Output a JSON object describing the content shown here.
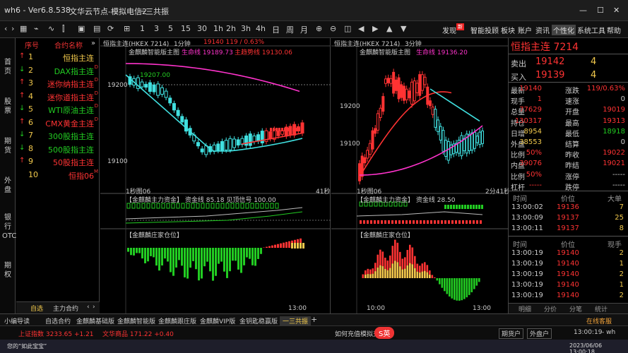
{
  "app": {
    "title": "wh6 - Ver6.8.538",
    "subtitle": "文华云节点-模拟电信2",
    "account": "一三共振"
  },
  "toolbar": {
    "periods": [
      "1",
      "3",
      "5",
      "15",
      "30",
      "1h",
      "2h",
      "3h",
      "4h",
      "日",
      "周",
      "月"
    ],
    "right": [
      "发现",
      "智能投顾",
      "板块",
      "账户",
      "资讯",
      "个性化",
      "系统工具",
      "帮助"
    ],
    "badge": "新"
  },
  "sidebar": [
    "首页",
    "股票",
    "期货",
    "外盘",
    "银行OTC",
    "期权"
  ],
  "list": {
    "headers": [
      "序号",
      "合约名称"
    ],
    "items": [
      {
        "no": "1",
        "name": "恒指主连",
        "dir": "up",
        "sup": ""
      },
      {
        "no": "2",
        "name": "DAX指主连",
        "dir": "down",
        "sup": "D"
      },
      {
        "no": "3",
        "name": "迷你纳指主连",
        "dir": "up",
        "sup": "D"
      },
      {
        "no": "4",
        "name": "迷你道指主连",
        "dir": "up",
        "sup": "D"
      },
      {
        "no": "5",
        "name": "WTI原油主连",
        "dir": "down",
        "sup": "D"
      },
      {
        "no": "6",
        "name": "CMX黄金主连",
        "dir": "up",
        "sup": "D"
      },
      {
        "no": "7",
        "name": "300股指主连",
        "dir": "down",
        "sup": ""
      },
      {
        "no": "8",
        "name": "500股指主连",
        "dir": "down",
        "sup": ""
      },
      {
        "no": "9",
        "name": "50股指主连",
        "dir": "up",
        "sup": ""
      },
      {
        "no": "10",
        "name": "恒指06",
        "dir": "",
        "sup": "M"
      }
    ],
    "tabs": [
      "自选",
      "主力合约"
    ]
  },
  "left_chart": {
    "header": "恒指主连(HKEX 7214)",
    "period": "1分钟",
    "title": "金麒麟智能版主图",
    "line1": "生命线 19189.73",
    "line2": "主趋势线 19130.06",
    "price_info": "19140   119 / 0.63%",
    "y_labels": [
      "19200",
      "19100"
    ],
    "mark": "19207.00",
    "footer_left": "1秒图06",
    "footer_right": "41秒",
    "sub1": "【金麒麟主力资金】 资金线 85.18  见顶信号 100.00",
    "sub2": "【金麒麟庄家仓位】",
    "time": "13:00"
  },
  "right_chart": {
    "header": "恒指主连(HKEX 7214)",
    "period": "3分钟",
    "title": "金麒麟智能版主图",
    "line1": "生命线 19136.20",
    "y_labels": [
      "19200",
      "19100"
    ],
    "footer_left": "1秒图06",
    "footer_right": "2分41秒",
    "sub1": "【金麒麟主力资金】 资金线 28.50",
    "sub2": "【金麒麟庄家仓位】",
    "time": "10:00",
    "time2": "13:00"
  },
  "quote": {
    "title": "恒指主连  7214",
    "sell": [
      "卖出",
      "19142",
      "4"
    ],
    "buy": [
      "买入",
      "19139",
      "4"
    ],
    "rows": [
      [
        "最新",
        "19140",
        "涨跌",
        "119/0.63%"
      ],
      [
        "现手",
        "1",
        "速涨",
        "0"
      ],
      [
        "总量",
        "77629",
        "开盘",
        "19019"
      ],
      [
        "持仓",
        "130317",
        "最高",
        "19313"
      ],
      [
        "日增",
        "8954",
        "最低",
        "18918"
      ],
      [
        "外盘",
        "38553",
        "结算",
        "0"
      ],
      [
        "比例",
        "50%",
        "昨收",
        "19022"
      ],
      [
        "内盘",
        "39076",
        "昨结",
        "19021"
      ],
      [
        "比例",
        "50%",
        "涨停",
        "-----"
      ],
      [
        "杠杆",
        "-----",
        "跌停",
        "-----"
      ]
    ],
    "ticks_head": [
      "时间",
      "价位",
      "大单"
    ],
    "ticks": [
      [
        "13:00:02",
        "19136",
        "7"
      ],
      [
        "13:00:09",
        "19137",
        "25"
      ],
      [
        "13:00:11",
        "19137",
        "8"
      ]
    ],
    "ticks_head2": [
      "时间",
      "价位",
      "现手"
    ],
    "ticks2": [
      [
        "13:00:19",
        "19140",
        "2"
      ],
      [
        "13:00:19",
        "19140",
        "1"
      ],
      [
        "13:00:19",
        "19140",
        "2"
      ],
      [
        "13:00:19",
        "19140",
        "1"
      ],
      [
        "13:00:19",
        "19140",
        "2"
      ]
    ],
    "tabs": [
      "明细",
      "分价",
      "分笔",
      "统计"
    ]
  },
  "bottom_tabs": [
    "小编导读",
    "自选合约",
    "金麒麟基础版",
    "金麒麟智能版",
    "金麒麟跟庄版",
    "金麒麟VIP版",
    "金钥匙稳赢版",
    "一三共振"
  ],
  "status": {
    "left1": "上证指数 3233.65 +1.21",
    "left2": "文华商品 171.22 +0.40",
    "center": "如何充值模拟交易",
    "right1": "期货户",
    "right2": "外盘户",
    "time": "13:00:19",
    "suffix": "- wh",
    "service": "在线客服"
  },
  "taskbar": {
    "left": "您的“如此宝宝”",
    "right": "2023/06/06 13:00:18"
  },
  "colors": {
    "up": "#ff3333",
    "down": "#22cc22",
    "cyan": "#40e0e0",
    "magenta": "#ff33cc"
  }
}
